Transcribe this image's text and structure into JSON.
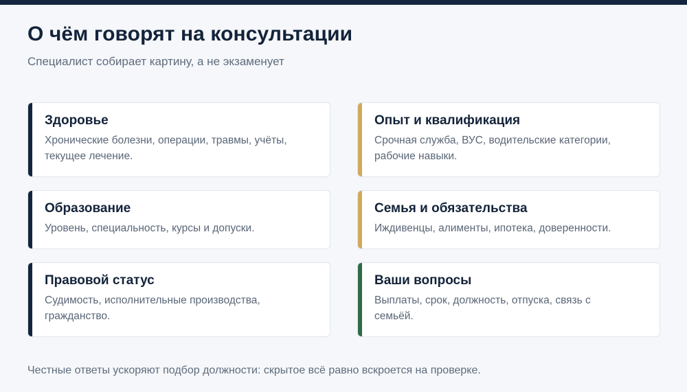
{
  "header": {
    "title": "О чём говорят на консультации",
    "subtitle": "Специалист собирает картину, а не экзаменует"
  },
  "colors": {
    "navy": "#13253f",
    "gold": "#d1a95c",
    "green": "#2f6b45"
  },
  "cards": [
    {
      "title": "Здоровье",
      "text": "Хронические болезни, операции, травмы, учёты, текущее лечение.",
      "accent": "#13253f"
    },
    {
      "title": "Опыт и квалификация",
      "text": "Срочная служба, ВУС, водительские категории, рабочие навыки.",
      "accent": "#d1a95c"
    },
    {
      "title": "Образование",
      "text": "Уровень, специальность, курсы и допуски.",
      "accent": "#13253f"
    },
    {
      "title": "Семья и обязательства",
      "text": "Иждивенцы, алименты, ипотека, доверенности.",
      "accent": "#d1a95c"
    },
    {
      "title": "Правовой статус",
      "text": "Судимость, исполнительные производства, гражданство.",
      "accent": "#13253f"
    },
    {
      "title": "Ваши вопросы",
      "text": "Выплаты, срок, должность, отпуска, связь с семьёй.",
      "accent": "#2f6b45"
    }
  ],
  "footer": {
    "note": "Честные ответы ускоряют подбор должности: скрытое всё равно вскроется на проверке."
  }
}
